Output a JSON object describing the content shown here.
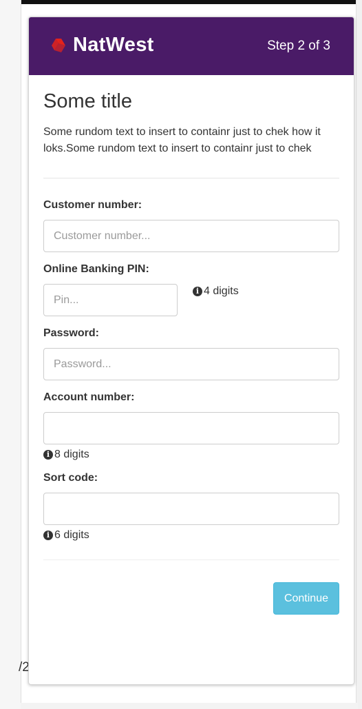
{
  "header": {
    "brand": "NatWest",
    "step": "Step 2 of 3",
    "brand_color": "#4a1b67",
    "logo_color": "#e5231b"
  },
  "intro": {
    "title": "Some title",
    "text": "Some rundom text to insert to containr just to chek how it loks.Some rundom text to insert to containr just to chek"
  },
  "form": {
    "customer_number": {
      "label": "Customer number:",
      "placeholder": "Customer number...",
      "value": ""
    },
    "pin": {
      "label": "Online Banking PIN:",
      "placeholder": "Pin...",
      "hint": "4 digits",
      "value": ""
    },
    "password": {
      "label": "Password:",
      "placeholder": "Password...",
      "value": ""
    },
    "account_number": {
      "label": "Account number:",
      "placeholder": "",
      "hint": "8 digits",
      "value": ""
    },
    "sort_code": {
      "label": "Sort code:",
      "placeholder": "",
      "hint": "6 digits",
      "value": ""
    }
  },
  "actions": {
    "continue_label": "Continue",
    "button_color": "#5bc0de"
  },
  "icons": {
    "info": "info-circle-icon",
    "logo": "natwest-cubes-icon"
  },
  "background": {
    "page_fragment": "/2"
  }
}
